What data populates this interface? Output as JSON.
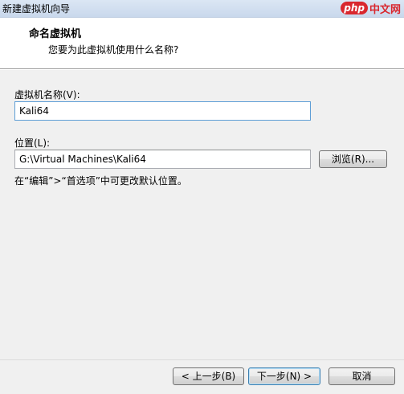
{
  "window": {
    "title": "新建虚拟机向导"
  },
  "watermark": {
    "php": "php",
    "site": "中文网"
  },
  "header": {
    "title": "命名虚拟机",
    "subtitle": "您要为此虚拟机使用什么名称?"
  },
  "form": {
    "name_label": "虚拟机名称(V):",
    "name_value": "Kali64",
    "location_label": "位置(L):",
    "location_value": "G:\\Virtual Machines\\Kali64",
    "browse_label": "浏览(R)...",
    "hint": "在“编辑”>“首选项”中可更改默认位置。"
  },
  "footer": {
    "back_label": "< 上一步(B)",
    "next_label": "下一步(N) >",
    "cancel_label": "取消"
  },
  "colors": {
    "accent_border": "#3c7fb1",
    "watermark_red": "#d9272e"
  }
}
